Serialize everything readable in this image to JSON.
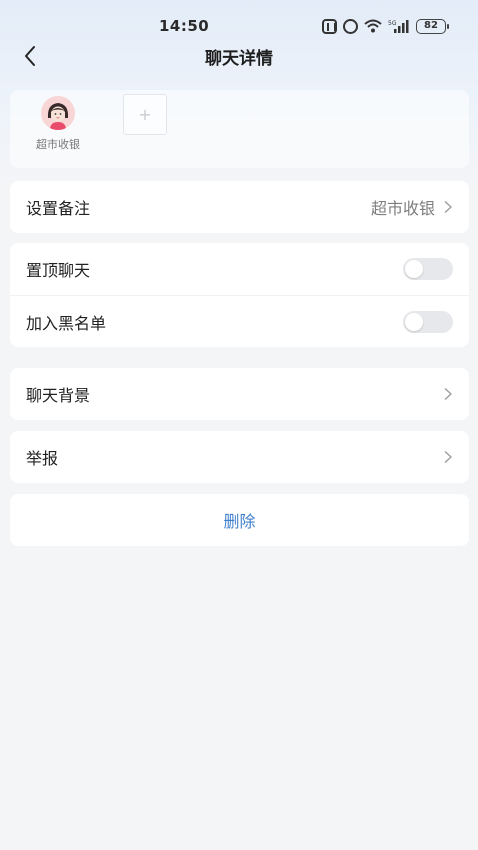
{
  "status_bar": {
    "time": "14:50",
    "battery": "82",
    "network": "5G"
  },
  "nav": {
    "title": "聊天详情",
    "back_icon": "chevron-left-icon"
  },
  "members": {
    "items": [
      {
        "name": "超市收银",
        "avatar": "avatar-girl"
      }
    ],
    "add_label": "+"
  },
  "settings": {
    "remark": {
      "label": "设置备注",
      "value": "超市收银"
    },
    "pin_chat": {
      "label": "置顶聊天",
      "on": false
    },
    "blacklist": {
      "label": "加入黑名单",
      "on": false
    },
    "chat_background": {
      "label": "聊天背景"
    },
    "report": {
      "label": "举报"
    },
    "delete": {
      "label": "删除"
    }
  },
  "colors": {
    "accent_delete": "#3f7fcc",
    "toggle_off": "#e6e8eb",
    "header_gradient": "#e3ecf8"
  }
}
